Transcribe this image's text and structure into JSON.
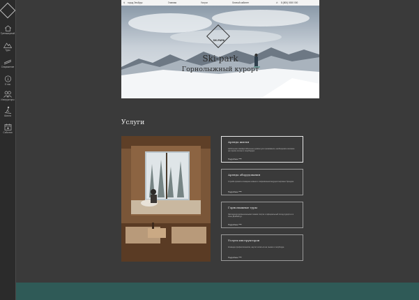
{
  "sidebar": {
    "logo_icon": "ski-park-diamond-logo",
    "items": [
      {
        "label": "Тренажерный",
        "icon": "home-icon"
      },
      {
        "label": "Туры",
        "icon": "mountain-icon"
      },
      {
        "label": "Снаряжение",
        "icon": "skis-icon"
      },
      {
        "label": "О нас",
        "icon": "info-icon"
      },
      {
        "label": "Инструкторы",
        "icon": "people-icon"
      },
      {
        "label": "Школа",
        "icon": "skier-icon"
      },
      {
        "label": "События",
        "icon": "calendar-icon"
      }
    ]
  },
  "topbar": {
    "location": "город Эльбрус",
    "nav": [
      "Главная",
      "Услуги",
      "Личный кабинет"
    ],
    "phone": "8 (800) 0000 000"
  },
  "hero": {
    "logo_text": "SKI-PARK",
    "title": "Ski-park",
    "subtitle": "Горнолыжный курорт"
  },
  "services": {
    "title": "Услуги",
    "cards": [
      {
        "title": "Аренда жилья",
        "desc": "Небольшие комфортабельные домики для проживания, необходимое желание на горном склоне и сноубордах.",
        "more": "Подробнее"
      },
      {
        "title": "Аренда оборудования",
        "desc": "Служба проката оснащена новым и современным ведущих мировых брендов.",
        "more": "Подробнее"
      },
      {
        "title": "Горнолыжные туры",
        "desc": "Экспедиция возвышенными пиками спорта и официальный поход курорта и в зоны Домбайтур.",
        "more": "Подробнее"
      },
      {
        "title": "Услуги инструкторов",
        "desc": "Команда профессионалов, научит кататься на лыжах и сноуборде.",
        "more": "Подробнее"
      }
    ]
  },
  "colors": {
    "background": "#3a3a3a",
    "sidebar": "#2b2b2b",
    "footer_accent": "#2f5a57"
  }
}
